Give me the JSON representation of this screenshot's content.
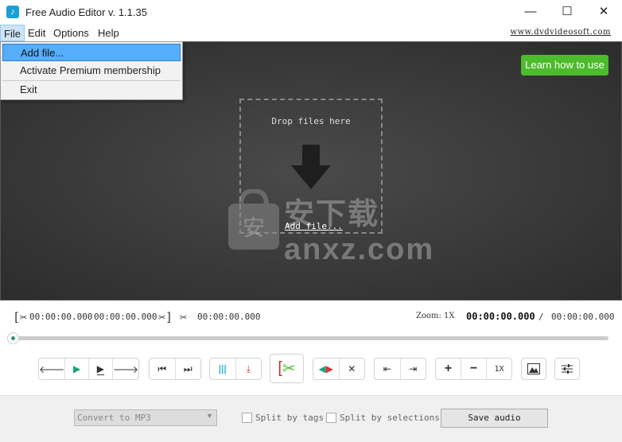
{
  "window": {
    "title": "Free Audio Editor v. 1.1.35",
    "minimize": "—",
    "maximize": "☐",
    "close": "✕"
  },
  "menu": {
    "items": [
      "File",
      "Edit",
      "Options",
      "Help"
    ],
    "site": "www.dvdvideosoft.com"
  },
  "file_menu": {
    "items": [
      "Add file...",
      "Activate Premium membership",
      "Exit"
    ]
  },
  "stage": {
    "learn": "Learn how to use",
    "drop_text": "Drop files here",
    "add_file": "Add file...",
    "watermark": "安下载 anxz.com"
  },
  "time": {
    "start": "00:00:00.000",
    "end": "00:00:00.000",
    "length": "00:00:00.000",
    "zoom": "Zoom: 1X",
    "current": "00:00:00.000",
    "separator": "/",
    "total": "00:00:00.000"
  },
  "progress": 0,
  "toolbar": {
    "zoom_reset": "1X"
  },
  "bottom": {
    "format": "Convert to MP3",
    "split_tags": "Split by tags",
    "split_selections": "Split by selections",
    "save": "Save audio"
  },
  "colors": {
    "accent_green": "#4cbb2c",
    "menu_highlight": "#56aefb",
    "play": "#1fa37a",
    "marker": "#3bb8d8",
    "red": "#d9363e"
  }
}
